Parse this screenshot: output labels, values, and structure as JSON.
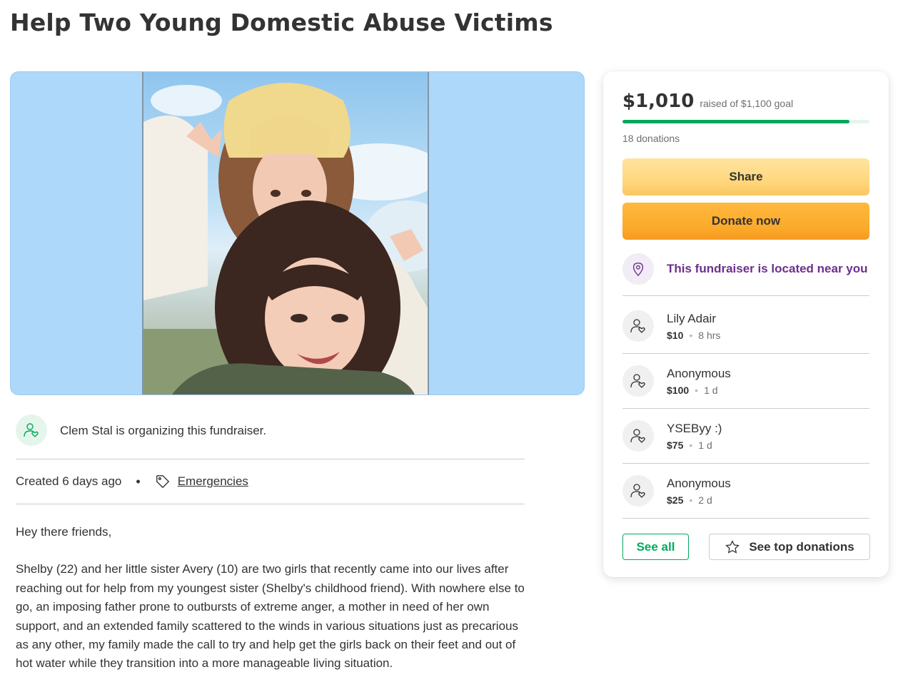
{
  "page": {
    "title": "Help Two Young Domestic Abuse Victims"
  },
  "organizer": {
    "text": "Clem Stal is organizing this fundraiser.",
    "icon": "person-heart-icon"
  },
  "meta": {
    "created": "Created 6 days ago",
    "separator": "•",
    "category": "Emergencies",
    "category_icon": "tag-icon"
  },
  "story": {
    "paragraphs": [
      "Hey there friends,",
      "Shelby (22) and her little sister Avery (10) are two girls that recently came into our lives after reaching out for help from my youngest sister (Shelby's childhood friend). With nowhere else to go, an imposing father prone to outbursts of extreme anger, a mother in need of her own support, and an extended family scattered to the winds in various situations just as precarious as any other, my family made the call to try and help get the girls back on their feet and out of hot water while they transition into a more manageable living situation."
    ]
  },
  "sidebar": {
    "amount": "$1,010",
    "goal_text": "raised of $1,100 goal",
    "progress_fraction": 0.918,
    "donation_count": "18 donations",
    "share_label": "Share",
    "donate_label": "Donate now",
    "location_text": "This fundraiser is located near you",
    "location_icon": "map-pin-icon",
    "donations": [
      {
        "name": "Lily Adair",
        "amount": "$10",
        "time": "8 hrs"
      },
      {
        "name": "Anonymous",
        "amount": "$100",
        "time": "1 d"
      },
      {
        "name": "YSEByy :)",
        "amount": "$75",
        "time": "1 d"
      },
      {
        "name": "Anonymous",
        "amount": "$25",
        "time": "2 d"
      }
    ],
    "see_all_label": "See all",
    "top_donations_label": "See top donations",
    "top_donations_icon": "star-icon"
  },
  "colors": {
    "brand_green": "#02a95c",
    "location_purple": "#6c2f8c",
    "donate_orange": "#fba92b",
    "share_yellow": "#ffd578"
  }
}
